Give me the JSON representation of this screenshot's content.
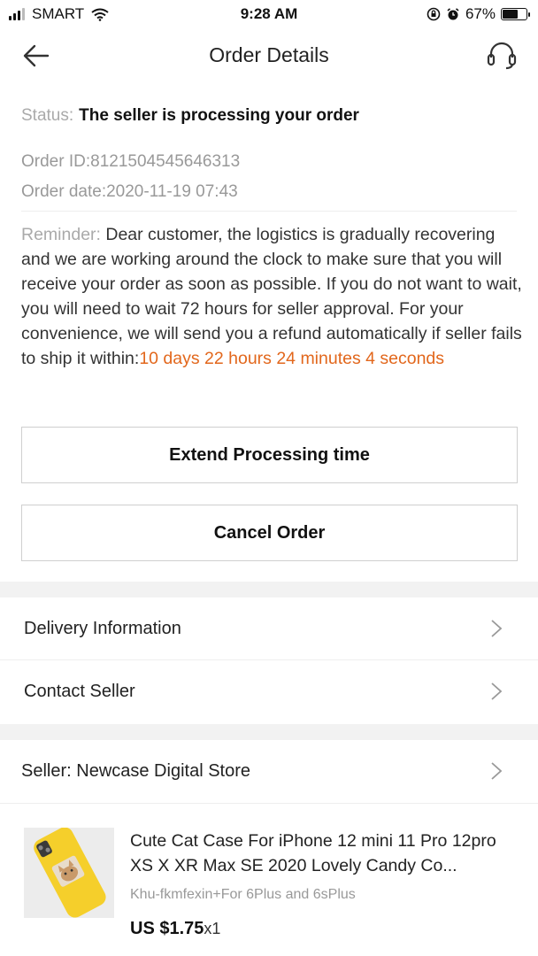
{
  "status_bar": {
    "carrier": "SMART",
    "time": "9:28 AM",
    "battery": "67%",
    "battery_level": 0.67
  },
  "nav": {
    "title": "Order Details"
  },
  "order": {
    "status_label": "Status:",
    "status_value": "The seller is processing your order",
    "order_id": "Order ID:8121504545646313",
    "order_date": "Order date:2020-11-19 07:43",
    "reminder_label": "Reminder:",
    "reminder_text": "Dear customer, the logistics is gradually recovering and we are working around the clock to make sure that you will receive your order as soon as possible. If you do not want to wait, you will need to wait 72 hours for seller approval. For your convenience, we will send you a refund automatically if seller fails to ship it within:",
    "countdown": "10 days 22 hours 24 minutes 4 seconds"
  },
  "actions": {
    "extend_label": "Extend Processing time",
    "cancel_label": "Cancel Order"
  },
  "rows": {
    "delivery_label": "Delivery Information",
    "contact_label": "Contact Seller",
    "seller_label": "Seller: Newcase Digital Store"
  },
  "product": {
    "title": "Cute Cat Case For iPhone 12 mini 11 Pro 12pro XS X XR Max SE 2020 Lovely Candy Co...",
    "variant": "Khu-fkmfexin+For 6Plus and 6sPlus",
    "price": "US $1.75",
    "quantity": "x1"
  },
  "colors": {
    "accent": "#e2671c",
    "muted": "#aaaaaa",
    "band": "#f2f2f2"
  }
}
